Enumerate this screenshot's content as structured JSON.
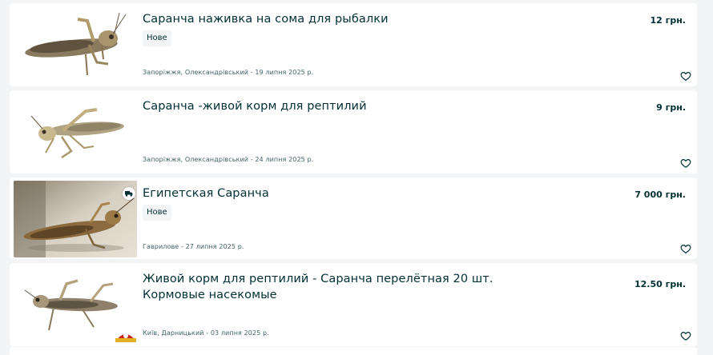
{
  "listings": [
    {
      "title": "Саранча наживка на сома для рыбалки",
      "badge": "Нове",
      "location_date": "Запоріжжя, Олександрівський - 19 липня 2025 р.",
      "price": "12 грн."
    },
    {
      "title": "Саранча -живой корм для рептилий",
      "location_date": "Запоріжжя, Олександрівський - 24 липня 2025 р.",
      "price": "9 грн."
    },
    {
      "title": "Египетская Саранча",
      "badge": "Нове",
      "location_date": "Гаврилове - 27 липня 2025 р.",
      "price": "7 000 грн.",
      "has_delivery": true
    },
    {
      "title": "Живой корм для рептилий - Саранча перелётная 20 шт. Кормовые насекомые",
      "location_date": "Київ, Дарницький - 03 липня 2025 р.",
      "price": "12.50 грн.",
      "has_shop_logo": true
    }
  ],
  "colors": {
    "background": "#f2f4f5",
    "card": "#ffffff",
    "text_primary": "#002f34",
    "text_secondary": "#406367",
    "badge_bg": "#f2f4f5"
  },
  "icons": {
    "favorite": "heart-outline-icon",
    "delivery": "truck-icon"
  }
}
